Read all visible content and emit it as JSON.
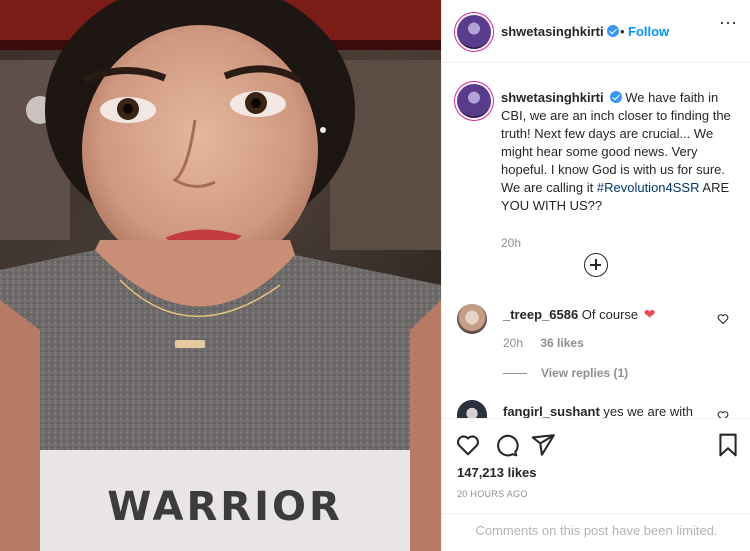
{
  "post": {
    "username": "shwetasinghkirti",
    "verified": true,
    "follow_label": "Follow",
    "dot": "•",
    "more_label": "···",
    "caption_username": "shwetasinghkirti",
    "caption_text": "We have faith in CBI, we are an inch closer to finding the truth! Next few days are crucial... We might hear some good news. Very hopeful. I know God is with us for sure. We are calling it",
    "caption_hashtag": "#Revolution4SSR",
    "caption_tail": "ARE YOU WITH US??",
    "caption_time": "20h",
    "likes": "147,213 likes",
    "posted": "20 HOURS AGO",
    "comments_limited": "Comments on this post have been limited.",
    "photo_shirt_text": "WARRIOR"
  },
  "comments": [
    {
      "username": "_treep_6586",
      "text": "Of course",
      "emoji": "❤",
      "time": "20h",
      "likes": "36 likes",
      "replies": "View replies (1)"
    },
    {
      "username": "fangirl_sushant",
      "text": "yes we are with"
    }
  ],
  "icons": {
    "like": "heart-icon",
    "comment": "comment-icon",
    "share": "share-icon",
    "save": "bookmark-icon",
    "load_more": "plus-circle-icon"
  },
  "colors": {
    "link_blue": "#0095f6",
    "verified_blue": "#3897f0",
    "hashtag": "#00376b",
    "heart_red": "#ed4956",
    "muted": "#8e8e8e"
  }
}
